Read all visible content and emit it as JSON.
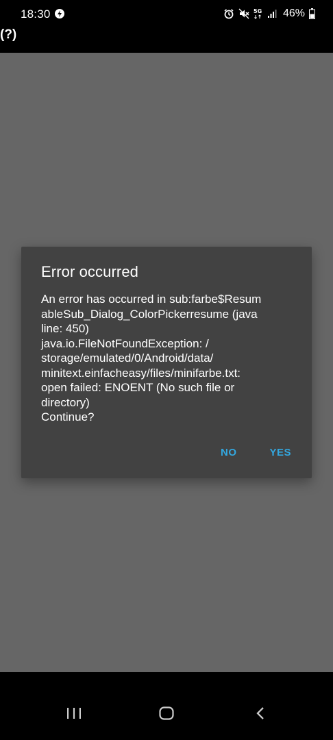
{
  "status_bar": {
    "time": "18:30",
    "battery": "46%",
    "icons": [
      "alarm-icon",
      "mute-icon",
      "5g-icon",
      "signal-icon",
      "battery-icon"
    ]
  },
  "app": {
    "title": "(?)"
  },
  "dialog": {
    "title": "Error occurred",
    "message_lines": [
      "An error has occurred in sub:farbe$Resum",
      "ableSub_Dialog_ColorPickerresume (java",
      "line: 450)",
      "java.io.FileNotFoundException: /",
      "storage/emulated/0/Android/data/",
      "minitext.einfacheasy/files/minifarbe.txt:",
      "open failed: ENOENT (No such file or",
      "directory)",
      "Continue?"
    ],
    "no_label": "NO",
    "yes_label": "YES",
    "accent_color": "#33a8e0"
  },
  "nav_bar": {
    "buttons": [
      "recent-apps-icon",
      "home-icon",
      "back-icon"
    ]
  }
}
